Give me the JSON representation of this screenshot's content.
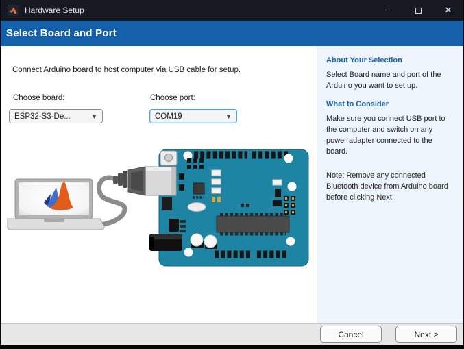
{
  "titlebar": {
    "app_icon": "matlab-logo",
    "title": "Hardware Setup",
    "minimize_glyph": "–",
    "close_glyph": "✕"
  },
  "banner": {
    "title": "Select Board and Port"
  },
  "main": {
    "instruction": "Connect Arduino board to host computer via USB cable for setup.",
    "board_label": "Choose board:",
    "board_value": "ESP32-S3-De...",
    "port_label": "Choose port:",
    "port_value": "COM19",
    "dropdown_arrow_glyph": "▼",
    "illustration_alt": "Laptop with MATLAB logo connected to Arduino board via USB cable"
  },
  "sidebar": {
    "about_heading": "About Your Selection",
    "about_text": "Select Board name and port of the Arduino you want to set up.",
    "consider_heading": "What to Consider",
    "consider_text": "Make sure you connect USB port to the computer and switch on any power adapter connected to the board.",
    "note_text": "Note: Remove any connected Bluetooth device from Arduino board before clicking Next."
  },
  "footer": {
    "cancel_label": "Cancel",
    "next_label": "Next >"
  },
  "colors": {
    "titlebar_bg": "#171a21",
    "banner_blue": "#1460aa",
    "heading_blue": "#1460aa",
    "sidebar_bg": "#eef4fb",
    "port_focus_border": "#45a7d9",
    "board_teal": "#1e84a3"
  }
}
